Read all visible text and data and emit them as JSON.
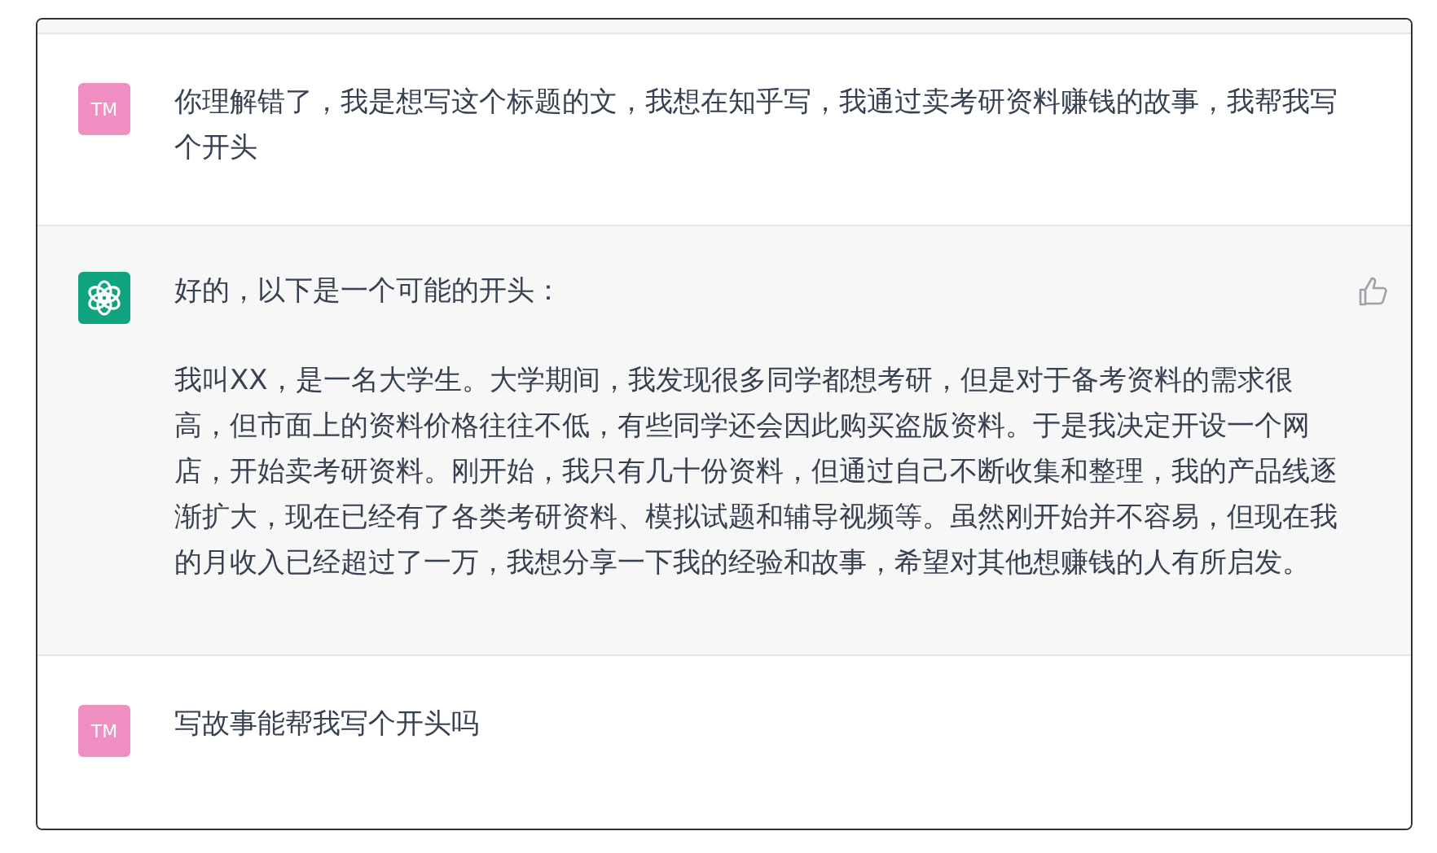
{
  "messages": [
    {
      "kind": "user",
      "avatar": "TM",
      "paragraphs": [
        "你理解错了，我是想写这个标题的文，我想在知乎写，我通过卖考研资料赚钱的故事，我帮我写个开头"
      ]
    },
    {
      "kind": "assistant",
      "paragraphs": [
        "好的，以下是一个可能的开头：",
        "我叫XX，是一名大学生。大学期间，我发现很多同学都想考研，但是对于备考资料的需求很高，但市面上的资料价格往往不低，有些同学还会因此购买盗版资料。于是我决定开设一个网店，开始卖考研资料。刚开始，我只有几十份资料，但通过自己不断收集和整理，我的产品线逐渐扩大，现在已经有了各类考研资料、模拟试题和辅导视频等。虽然刚开始并不容易，但现在我的月收入已经超过了一万，我想分享一下我的经验和故事，希望对其他想赚钱的人有所启发。"
      ]
    },
    {
      "kind": "user",
      "avatar": "TM",
      "paragraphs": [
        "写故事能帮我写个开头吗"
      ]
    }
  ]
}
